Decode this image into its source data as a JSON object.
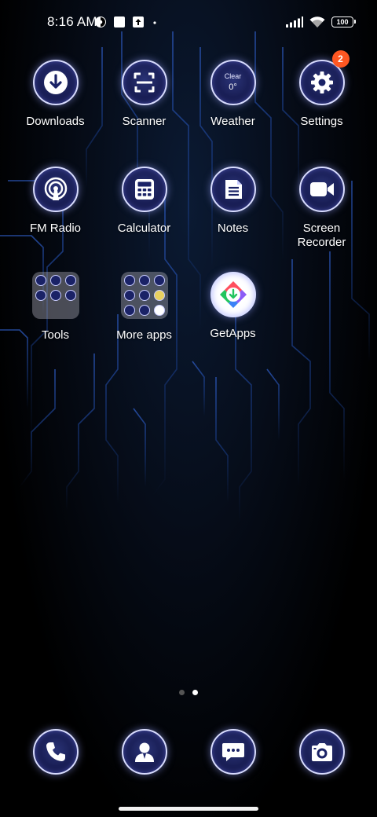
{
  "status_bar": {
    "time": "8:16 AM",
    "battery": "100"
  },
  "apps": {
    "downloads": {
      "label": "Downloads"
    },
    "scanner": {
      "label": "Scanner"
    },
    "weather": {
      "label": "Weather",
      "condition": "Clear",
      "temperature": "0°"
    },
    "settings": {
      "label": "Settings",
      "badge": "2"
    },
    "fm_radio": {
      "label": "FM Radio"
    },
    "calculator": {
      "label": "Calculator"
    },
    "notes": {
      "label": "Notes"
    },
    "screen_recorder": {
      "label_line1": "Screen",
      "label_line2": "Recorder"
    },
    "tools": {
      "label": "Tools"
    },
    "more_apps": {
      "label": "More apps"
    },
    "getapps": {
      "label": "GetApps"
    }
  },
  "dock": {
    "icons": [
      "phone-icon",
      "contacts-icon",
      "messages-icon",
      "camera-icon"
    ]
  },
  "page_indicator": {
    "pages": 2,
    "active": 2
  },
  "colors": {
    "icon_ring": "#d8dcff",
    "icon_fill": "#14184a",
    "badge": "#ff5722",
    "circuit": "#1e4aa8"
  }
}
